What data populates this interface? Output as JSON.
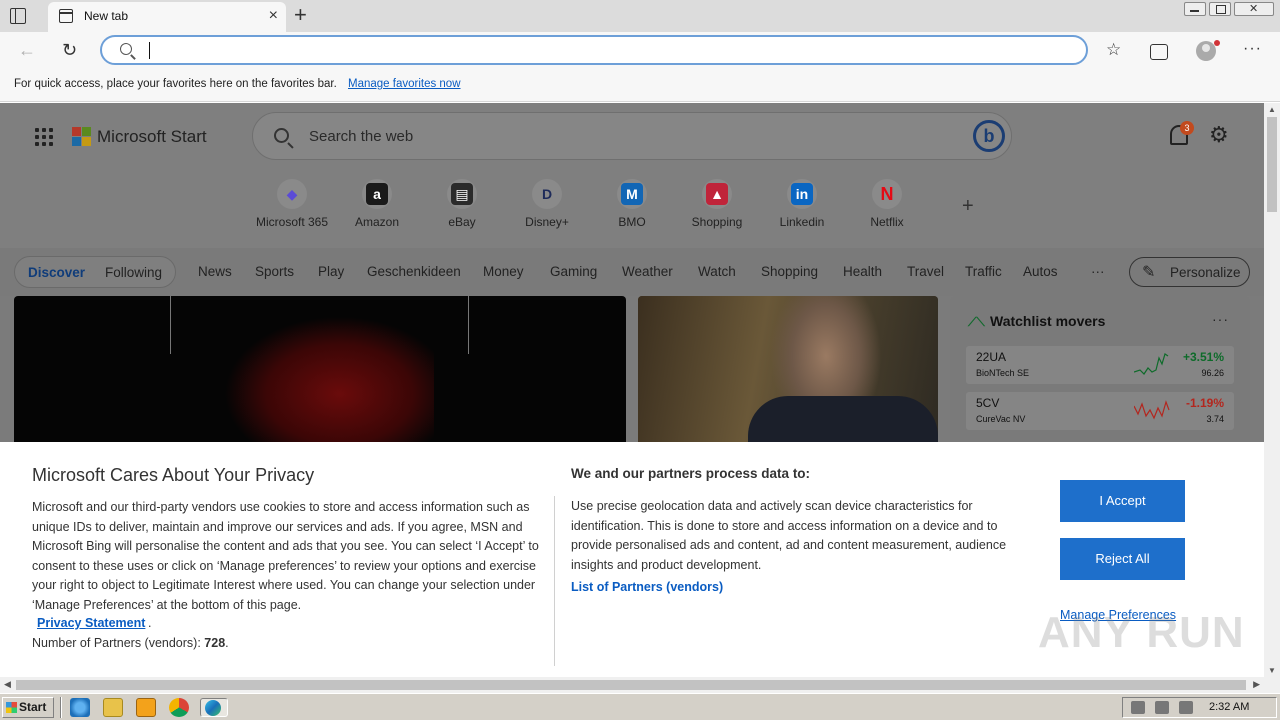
{
  "browser": {
    "tab_title": "New tab",
    "new_tab_symbol": "+",
    "tab_close_symbol": "×",
    "address_value": "",
    "favorites_bar_text": "For quick access, place your favorites here on the favorites bar.",
    "favorites_bar_link": "Manage favorites now"
  },
  "page": {
    "brand": "Microsoft Start",
    "search_placeholder": "Search the web",
    "bing_button": "b",
    "notification_count": "3",
    "quick_links": [
      {
        "label": "Microsoft 365",
        "glyph": "◆",
        "color": "#5b4bd6"
      },
      {
        "label": "Amazon",
        "glyph": "a",
        "color": "#1a1a1a"
      },
      {
        "label": "eBay",
        "glyph": "▤",
        "color": "#2b2b2b"
      },
      {
        "label": "Disney+",
        "glyph": "D",
        "color": "#1e2b5a"
      },
      {
        "label": "BMO",
        "glyph": "M",
        "color": "#1266b5"
      },
      {
        "label": "Shopping",
        "glyph": "▲",
        "color": "#c0243a"
      },
      {
        "label": "Linkedin",
        "glyph": "in",
        "color": "#0a66c2"
      },
      {
        "label": "Netflix",
        "glyph": "N",
        "color": "#e50914"
      }
    ],
    "add_quick_link": "+",
    "nav_pill": {
      "discover": "Discover",
      "following": "Following"
    },
    "nav_items": [
      "News",
      "Sports",
      "Play",
      "Geschenkideen",
      "Money",
      "Gaming",
      "Weather",
      "Watch",
      "Shopping",
      "Health",
      "Travel",
      "Traffic",
      "Autos",
      "···"
    ],
    "personalize": "Personalize",
    "watchlist": {
      "title": "Watchlist movers",
      "more": "···",
      "stocks": [
        {
          "symbol": "22UA",
          "name": "BioNTech SE",
          "change": "+3.51%",
          "value": "96.26",
          "color": "#0e6b2a"
        },
        {
          "symbol": "5CV",
          "name": "CureVac NV",
          "change": "-1.19%",
          "value": "3.74",
          "color": "#b3261e"
        }
      ]
    }
  },
  "privacy": {
    "title": "Microsoft Cares About Your Privacy",
    "body": "Microsoft and our third-party vendors use cookies to store and access information such as unique IDs to deliver, maintain and improve our services and ads. If you agree, MSN and Microsoft Bing will personalise the content and ads that you see. You can select ‘I Accept’ to consent to these uses or click on ‘Manage preferences’ to review your options and exercise your right to object to Legitimate Interest where used.  You can change your selection under ‘Manage Preferences’ at the bottom of this page.",
    "privacy_link": "Privacy Statement",
    "partners_label": "Number of Partners (vendors):",
    "partners_count": "728",
    "process_heading": "We and our partners process data to:",
    "process_body": "Use precise geolocation data and actively scan device characteristics for identification. This is done to store and access information on a device and to provide personalised ads and content, ad and content measurement, audience insights and product development.",
    "vendors_link": "List of Partners (vendors)",
    "accept": "I Accept",
    "reject": "Reject All",
    "manage": "Manage Preferences"
  },
  "watermark": "ANY RUN",
  "taskbar": {
    "start": "Start",
    "clock": "2:32 AM"
  }
}
